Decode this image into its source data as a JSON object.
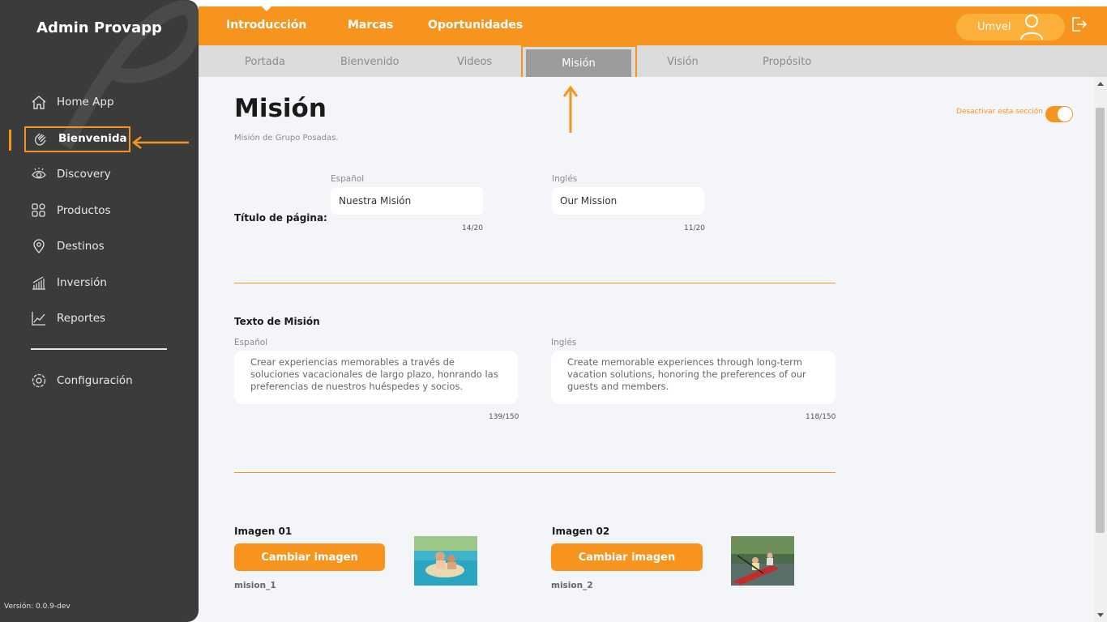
{
  "sidebar": {
    "brand": "Admin Provapp",
    "items": [
      {
        "label": "Home App",
        "icon": "home-icon"
      },
      {
        "label": "Bienvenida",
        "icon": "wave-hand-icon"
      },
      {
        "label": "Discovery",
        "icon": "eye-icon"
      },
      {
        "label": "Productos",
        "icon": "grid-icon"
      },
      {
        "label": "Destinos",
        "icon": "map-pin-icon"
      },
      {
        "label": "Inversión",
        "icon": "bar-growth-icon"
      },
      {
        "label": "Reportes",
        "icon": "line-chart-icon"
      }
    ],
    "config_label": "Configuración",
    "version": "Versión: 0.0.9-dev"
  },
  "topnav": {
    "tabs": [
      "Introducción",
      "Marcas",
      "Oportunidades"
    ],
    "user_name": "Umvel"
  },
  "subtabs": [
    "Portada",
    "Bienvenido",
    "Videos",
    "Misión",
    "Visión",
    "Propósito"
  ],
  "page": {
    "title": "Misión",
    "subtitle": "Misión de Grupo Posadas.",
    "toggle_label": "Desactivar esta sección",
    "toggle_on": true
  },
  "titulo_section": {
    "label": "Título de página:",
    "es_label": "Español",
    "es_value": "Nuestra Misión",
    "es_count": "14/20",
    "en_label": "Inglés",
    "en_value": "Our Mission",
    "en_count": "11/20"
  },
  "texto_section": {
    "label": "Texto de Misión",
    "es_label": "Español",
    "es_value": "Crear experiencias memorables a través de soluciones vacacionales de largo plazo, honrando las preferencias de nuestros huéspedes y socios.",
    "es_count": "139/150",
    "en_label": "Inglés",
    "en_value": "Create memorable experiences through long-term vacation solutions, honoring the preferences of our guests and members.",
    "en_count": "118/150"
  },
  "images": [
    {
      "label": "Imagen 01",
      "button": "Cambiar imagen",
      "filename": "mision_1"
    },
    {
      "label": "Imagen 02",
      "button": "Cambiar imagen",
      "filename": "mision_2"
    }
  ],
  "colors": {
    "accent": "#f7941d",
    "sidebar_bg": "#3b3b3b",
    "content_bg": "#f4f5f8"
  }
}
